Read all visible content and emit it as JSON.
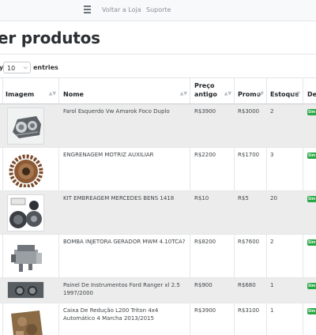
{
  "nav": {
    "voltar": "Voltar a Loja",
    "suporte": "Suporte"
  },
  "page": {
    "title": "er produtos"
  },
  "length": {
    "prefix": "y",
    "value": "10",
    "suffix": "entries"
  },
  "columns": {
    "imagem": "Imagem",
    "nome": "Nome",
    "preco": "Preço antigo",
    "promo": "Promo",
    "estoque": "Estoque",
    "destaque": "De"
  },
  "rows": [
    {
      "nome": "Farol Esquerdo Vw Amarok Foco Duplo",
      "preco": "R$3900",
      "promo": "R$3000",
      "estoque": "2",
      "badge": "Sim",
      "image": "headlight"
    },
    {
      "nome": "ENGRENAGEM MOTRIZ AUXILIAR",
      "preco": "R$2200",
      "promo": "R$1700",
      "estoque": "3",
      "badge": "Sim",
      "image": "gear"
    },
    {
      "nome": "KIT EMBREAGEM MERCEDES BENS 1418",
      "preco": "R$10",
      "promo": "R$5",
      "estoque": "20",
      "badge": "Sim",
      "image": "clutch-kit"
    },
    {
      "nome": "BOMBA INJETORA GERADOR MWM 4.10TCA?",
      "preco": "R$8200",
      "promo": "R$7600",
      "estoque": "2",
      "badge": "Sim",
      "image": "injection-pump"
    },
    {
      "nome": "Painel De Instrumentos Ford Ranger xl 2.5 1997/2000",
      "preco": "R$900",
      "promo": "R$680",
      "estoque": "1",
      "badge": "Sim",
      "image": "instrument-panel"
    },
    {
      "nome": "Caixa De Redução L200 Triton 4x4 Automático 4 Marcha 2013/2015",
      "preco": "R$3900",
      "promo": "R$3100",
      "estoque": "1",
      "badge": "Sim",
      "image": "gearbox"
    }
  ],
  "colors": {
    "badge": "#28a745",
    "row_alt": "#ececec",
    "navbar": "#f8f9fa"
  }
}
